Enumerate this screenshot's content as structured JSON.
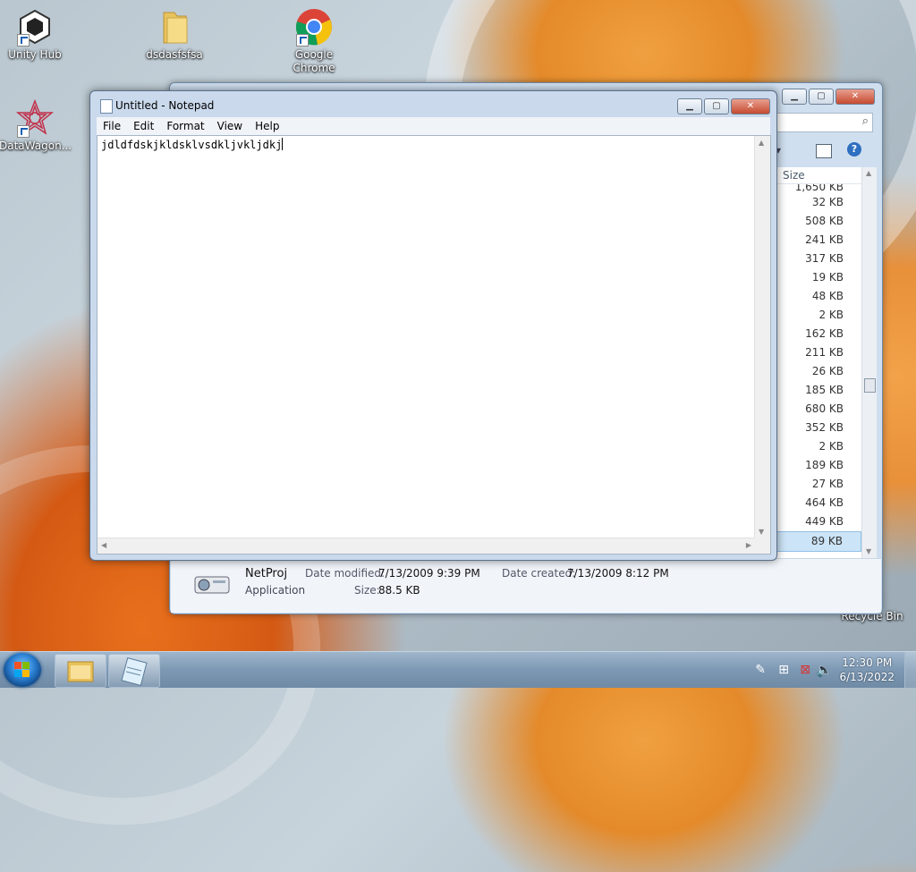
{
  "desktop": {
    "icons": [
      {
        "label": "Unity Hub"
      },
      {
        "label": "dsdasfsfsa"
      },
      {
        "label": "Google Chrome"
      },
      {
        "label": "DataWagon..."
      },
      {
        "label": "Recycle Bin"
      }
    ]
  },
  "explorer": {
    "size_header": "Size",
    "sizes": [
      "1,650 KB",
      "32 KB",
      "508 KB",
      "241 KB",
      "317 KB",
      "19 KB",
      "48 KB",
      "2 KB",
      "162 KB",
      "211 KB",
      "26 KB",
      "185 KB",
      "680 KB",
      "352 KB",
      "2 KB",
      "189 KB",
      "27 KB",
      "464 KB",
      "449 KB",
      "89 KB"
    ],
    "details": {
      "name": "NetProj",
      "type": "Application",
      "date_modified_label": "Date modified:",
      "date_modified": "7/13/2009 9:39 PM",
      "date_created_label": "Date created:",
      "date_created": "7/13/2009 8:12 PM",
      "size_label": "Size:",
      "size": "88.5 KB"
    }
  },
  "notepad": {
    "title": "Untitled - Notepad",
    "menu": [
      "File",
      "Edit",
      "Format",
      "View",
      "Help"
    ],
    "content": "jdldfdskjkldsklvsdkljvkljdkj"
  },
  "taskbar": {
    "time": "12:30 PM",
    "date": "6/13/2022"
  },
  "colors": {
    "accent": "#1a5fb4",
    "close_red": "#c74a30"
  }
}
